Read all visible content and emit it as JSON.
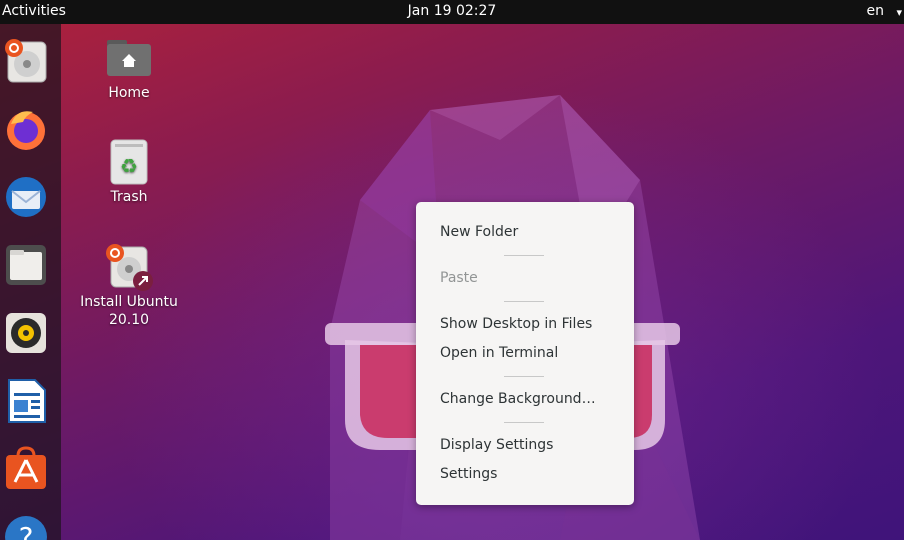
{
  "topbar": {
    "activities": "Activities",
    "clock": "Jan 19  02:27",
    "language": "en",
    "menu_arrow": "▾"
  },
  "dock": {
    "items": [
      {
        "name": "install-ubuntu",
        "icon": "installer-icon"
      },
      {
        "name": "firefox",
        "icon": "firefox-icon"
      },
      {
        "name": "thunderbird",
        "icon": "thunderbird-icon"
      },
      {
        "name": "files",
        "icon": "files-icon"
      },
      {
        "name": "rhythmbox",
        "icon": "rhythmbox-icon"
      },
      {
        "name": "libreoffice-writer",
        "icon": "writer-icon"
      },
      {
        "name": "ubuntu-software",
        "icon": "software-icon"
      },
      {
        "name": "help",
        "icon": "help-icon"
      }
    ]
  },
  "desktop": {
    "icons": [
      {
        "label": "Home"
      },
      {
        "label": "Trash"
      },
      {
        "label_line1": "Install Ubuntu",
        "label_line2": "20.10"
      }
    ]
  },
  "context_menu": {
    "items": [
      {
        "label": "New Folder",
        "enabled": true
      },
      {
        "label": "Paste",
        "enabled": false
      },
      {
        "label": "Show Desktop in Files",
        "enabled": true
      },
      {
        "label": "Open in Terminal",
        "enabled": true
      },
      {
        "label": "Change Background…",
        "enabled": true
      },
      {
        "label": "Display Settings",
        "enabled": true
      },
      {
        "label": "Settings",
        "enabled": true
      }
    ]
  },
  "colors": {
    "topbar": "#111111",
    "menu_bg": "#f6f5f4",
    "accent": "#e95420"
  }
}
